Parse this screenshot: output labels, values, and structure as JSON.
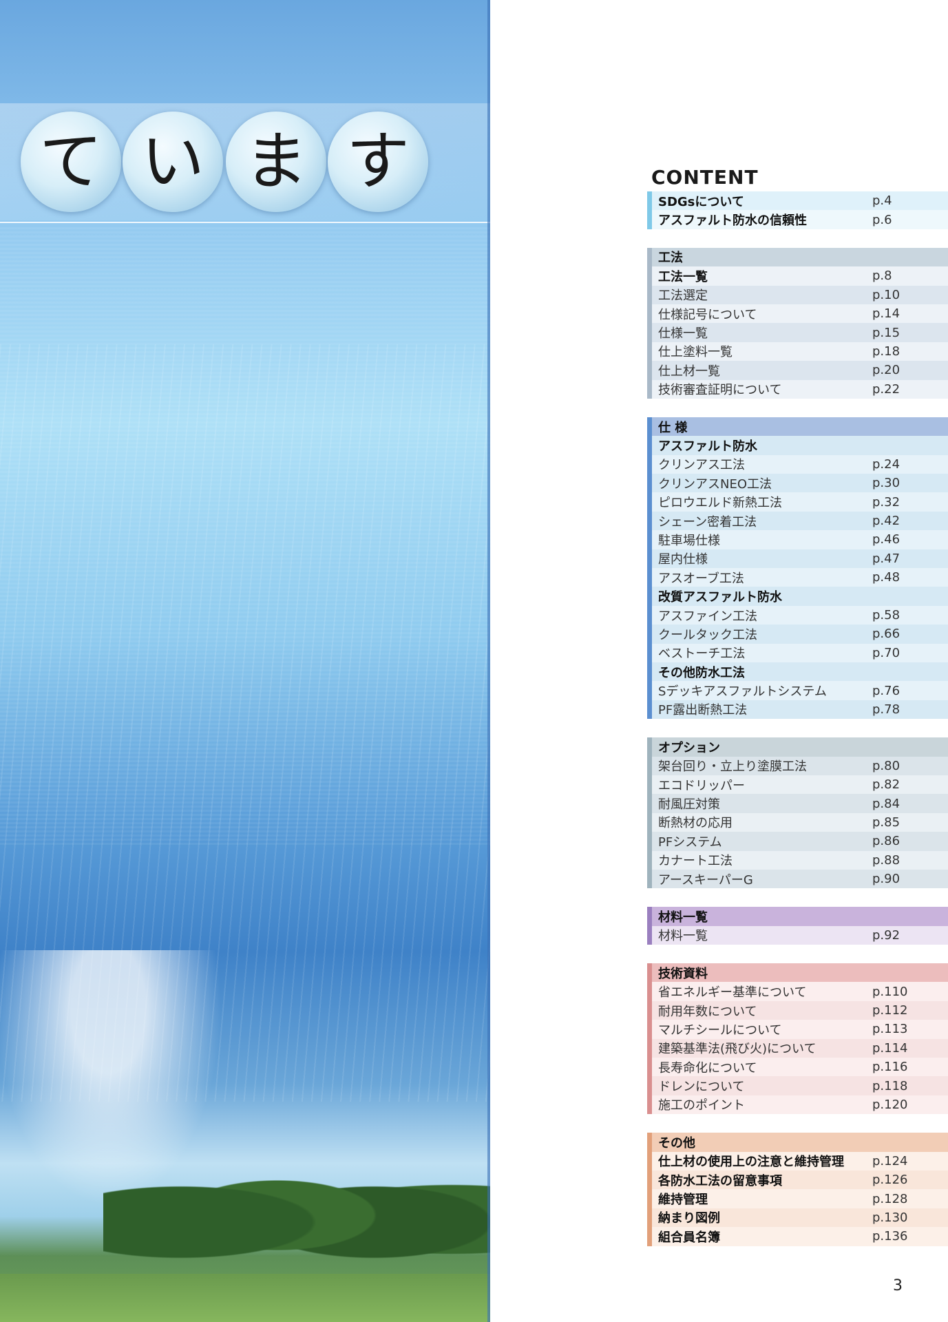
{
  "hero": {
    "chars": [
      "て",
      "い",
      "ま",
      "す"
    ]
  },
  "toc": {
    "title": "CONTENT",
    "sections": [
      {
        "theme": {
          "bar": "#7fc9e8",
          "a": "#dff1fa",
          "b": "#eef8fc",
          "h": "#dff1fa"
        },
        "items": [
          {
            "label": "SDGsについて",
            "page": "p.4",
            "style": "bold"
          },
          {
            "label": "アスファルト防水の信頼性",
            "page": "p.6",
            "style": "bold"
          }
        ]
      },
      {
        "theme": {
          "bar": "#a9b9c8",
          "a": "#dce5ee",
          "b": "#edf2f7",
          "h": "#c9d6df"
        },
        "items": [
          {
            "label": "工法",
            "page": "",
            "style": "head"
          },
          {
            "label": "工法一覧",
            "page": "p.8",
            "style": "bold"
          },
          {
            "label": "工法選定",
            "page": "p.10",
            "style": ""
          },
          {
            "label": "仕様記号について",
            "page": "p.14",
            "style": ""
          },
          {
            "label": "仕様一覧",
            "page": "p.15",
            "style": ""
          },
          {
            "label": "仕上塗料一覧",
            "page": "p.18",
            "style": ""
          },
          {
            "label": "仕上材一覧",
            "page": "p.20",
            "style": ""
          },
          {
            "label": "技術審査証明について",
            "page": "p.22",
            "style": ""
          }
        ]
      },
      {
        "theme": {
          "bar": "#5b8fd0",
          "a": "#e6f2f9",
          "b": "#d6e9f4",
          "h": "#a9bfe2"
        },
        "items": [
          {
            "label": "仕 様",
            "page": "",
            "style": "head"
          },
          {
            "label": "アスファルト防水",
            "page": "",
            "style": "bold"
          },
          {
            "label": "クリンアス工法",
            "page": "p.24",
            "style": ""
          },
          {
            "label": "クリンアスNEO工法",
            "page": "p.30",
            "style": ""
          },
          {
            "label": "ピロウエルド新熱工法",
            "page": "p.32",
            "style": ""
          },
          {
            "label": "シェーン密着工法",
            "page": "p.42",
            "style": ""
          },
          {
            "label": "駐車場仕様",
            "page": "p.46",
            "style": ""
          },
          {
            "label": "屋内仕様",
            "page": "p.47",
            "style": ""
          },
          {
            "label": "アスオーブ工法",
            "page": "p.48",
            "style": ""
          },
          {
            "label": "改質アスファルト防水",
            "page": "",
            "style": "bold"
          },
          {
            "label": "アスファイン工法",
            "page": "p.58",
            "style": ""
          },
          {
            "label": "クールタック工法",
            "page": "p.66",
            "style": ""
          },
          {
            "label": "ベストーチ工法",
            "page": "p.70",
            "style": ""
          },
          {
            "label": "その他防水工法",
            "page": "",
            "style": "bold"
          },
          {
            "label": "Sデッキアスファルトシステム",
            "page": "p.76",
            "style": ""
          },
          {
            "label": "PF露出断熱工法",
            "page": "p.78",
            "style": ""
          }
        ]
      },
      {
        "theme": {
          "bar": "#9fb3bd",
          "a": "#eaf0f4",
          "b": "#dbe4ea",
          "h": "#c9d5da"
        },
        "items": [
          {
            "label": "オプション",
            "page": "",
            "style": "head"
          },
          {
            "label": "架台回り・立上り塗膜工法",
            "page": "p.80",
            "style": ""
          },
          {
            "label": "エコドリッパー",
            "page": "p.82",
            "style": ""
          },
          {
            "label": "耐風圧対策",
            "page": "p.84",
            "style": ""
          },
          {
            "label": "断熱材の応用",
            "page": "p.85",
            "style": ""
          },
          {
            "label": "PFシステム",
            "page": "p.86",
            "style": ""
          },
          {
            "label": "カナート工法",
            "page": "p.88",
            "style": ""
          },
          {
            "label": "アースキーパーG",
            "page": "p.90",
            "style": ""
          }
        ]
      },
      {
        "theme": {
          "bar": "#9a7fbf",
          "a": "#ece4f3",
          "b": "#ece4f3",
          "h": "#c9b3dc"
        },
        "items": [
          {
            "label": "材料一覧",
            "page": "",
            "style": "head"
          },
          {
            "label": "材料一覧",
            "page": "p.92",
            "style": ""
          }
        ]
      },
      {
        "theme": {
          "bar": "#d98f8f",
          "a": "#f6e3e3",
          "b": "#fbeeee",
          "h": "#ecbdbd"
        },
        "items": [
          {
            "label": "技術資料",
            "page": "",
            "style": "head"
          },
          {
            "label": "省エネルギー基準について",
            "page": "p.110",
            "style": ""
          },
          {
            "label": "耐用年数について",
            "page": "p.112",
            "style": ""
          },
          {
            "label": "マルチシールについて",
            "page": "p.113",
            "style": ""
          },
          {
            "label": "建築基準法(飛び火)について",
            "page": "p.114",
            "style": ""
          },
          {
            "label": "長寿命化について",
            "page": "p.116",
            "style": ""
          },
          {
            "label": "ドレンについて",
            "page": "p.118",
            "style": ""
          },
          {
            "label": "施工のポイント",
            "page": "p.120",
            "style": ""
          }
        ]
      },
      {
        "theme": {
          "bar": "#e2a07a",
          "a": "#f9e6da",
          "b": "#fcf0e8",
          "h": "#f2cdb6"
        },
        "items": [
          {
            "label": "その他",
            "page": "",
            "style": "head"
          },
          {
            "label": "仕上材の使用上の注意と維持管理",
            "page": "p.124",
            "style": "bold"
          },
          {
            "label": "各防水工法の留意事項",
            "page": "p.126",
            "style": "bold"
          },
          {
            "label": "維持管理",
            "page": "p.128",
            "style": "bold"
          },
          {
            "label": "納まり図例",
            "page": "p.130",
            "style": "bold"
          },
          {
            "label": "組合員名簿",
            "page": "p.136",
            "style": "bold"
          }
        ]
      }
    ]
  },
  "page_number": "3"
}
